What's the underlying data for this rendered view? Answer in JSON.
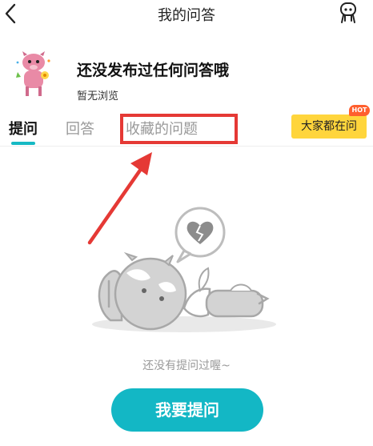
{
  "header": {
    "title": "我的问答"
  },
  "profile": {
    "name": "还没发布过任何问答哦",
    "subtitle": "暂无浏览"
  },
  "tabs": [
    {
      "label": "提问",
      "active": true
    },
    {
      "label": "回答",
      "active": false
    },
    {
      "label": "收藏的问题",
      "active": false
    }
  ],
  "hot": {
    "button_label": "大家都在问",
    "badge": "HOT"
  },
  "empty_state": {
    "message": "还没有提问过喔~",
    "cta_label": "我要提问"
  },
  "colors": {
    "accent": "#13b7c5",
    "highlight": "#e53935",
    "hot_button": "#ffd53c",
    "hot_badge": "#ff5f2e"
  }
}
